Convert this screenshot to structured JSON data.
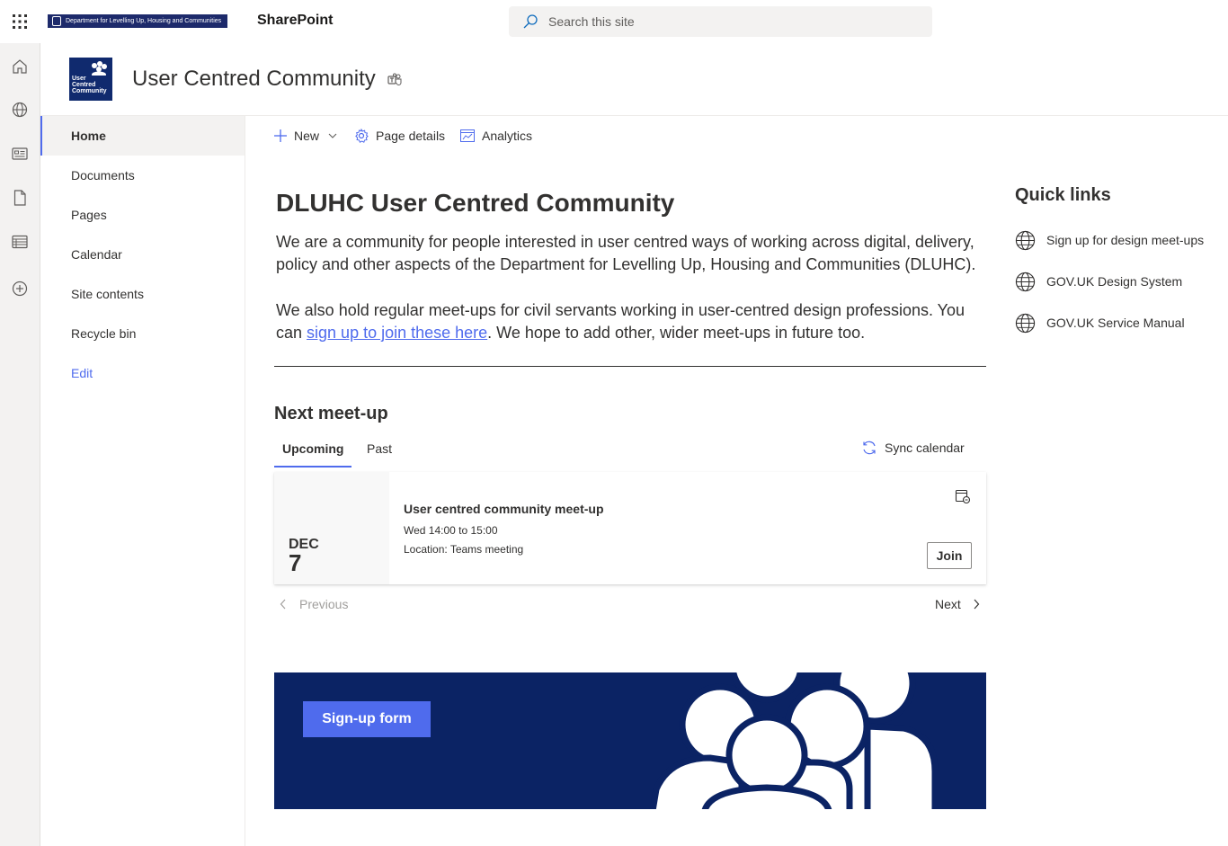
{
  "suite": {
    "org_logo_text": "Department for Levelling Up, Housing and Communities",
    "app_name": "SharePoint",
    "search_placeholder": "Search this site"
  },
  "site": {
    "logo_text_1": "User",
    "logo_text_2": "Centred",
    "logo_text_3": "Community",
    "title": "User Centred Community"
  },
  "nav": {
    "items": [
      {
        "label": "Home",
        "active": true
      },
      {
        "label": "Documents"
      },
      {
        "label": "Pages"
      },
      {
        "label": "Calendar"
      },
      {
        "label": "Site contents"
      },
      {
        "label": "Recycle bin"
      }
    ],
    "edit_label": "Edit"
  },
  "command_bar": {
    "new_label": "New",
    "page_details_label": "Page details",
    "analytics_label": "Analytics"
  },
  "main": {
    "title": "DLUHC User Centred Community",
    "intro": "We are a community for people interested in user centred ways of working across digital, delivery, policy and other aspects of the Department for Levelling Up, Housing and Communities (DLUHC).",
    "meetups_before": "We also hold regular meet-ups for civil servants working in user-centred design professions. You can ",
    "meetups_link": "sign up to join these here",
    "meetups_after": ". We hope to add other, wider meet-ups in future too."
  },
  "events": {
    "section_title": "Next meet-up",
    "tabs": [
      "Upcoming",
      "Past"
    ],
    "sync_label": "Sync calendar",
    "event": {
      "month": "DEC",
      "day": "7",
      "title": "User centred community meet-up",
      "time": "Wed 14:00 to 15:00",
      "location": "Location: Teams meeting",
      "join_label": "Join"
    },
    "previous_label": "Previous",
    "next_label": "Next"
  },
  "banner": {
    "button_label": "Sign-up form"
  },
  "quick_links": {
    "title": "Quick links",
    "items": [
      "Sign up for design meet-ups",
      "GOV.UK Design System",
      "GOV.UK Service Manual"
    ]
  },
  "colors": {
    "accent": "#4f6bed",
    "banner_bg": "#0b2364",
    "logo_bg": "#102a6e"
  }
}
